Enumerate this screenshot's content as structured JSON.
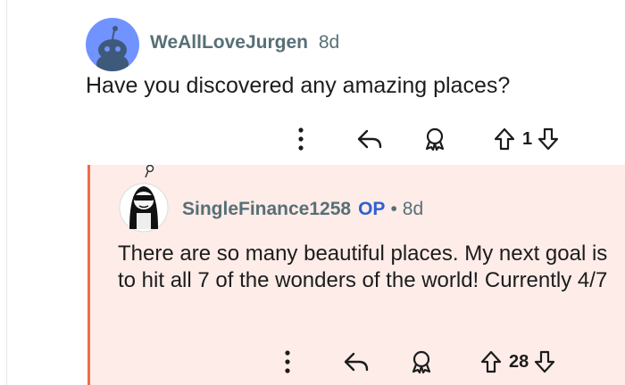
{
  "comment": {
    "username": "WeAllLoveJurgen",
    "age": "8d",
    "text": "Have you discovered any amazing places?",
    "score": "1"
  },
  "reply": {
    "username": "SingleFinance1258",
    "op_badge": "OP",
    "separator": "•",
    "age": "8d",
    "text": "There are so many beautiful places. My next goal is to hit all 7 of the wonders of the world! Currently 4/7",
    "score": "28"
  },
  "icons": [
    "more-vertical-icon",
    "reply-arrow-icon",
    "award-icon",
    "upvote-arrow-icon",
    "downvote-arrow-icon"
  ],
  "colors": {
    "accent": "#f26b45",
    "reply_bg": "#fdece8",
    "op": "#2f5fd0",
    "avatar": "#7193ff"
  }
}
